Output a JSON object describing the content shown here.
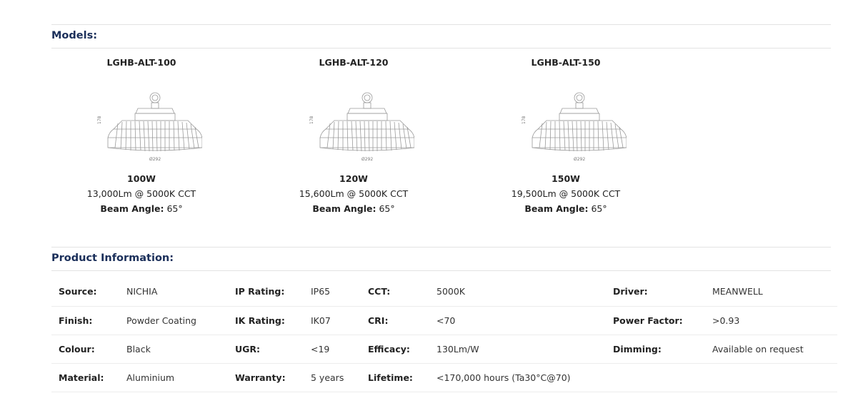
{
  "models_heading": "Models:",
  "product_info_heading": "Product Information:",
  "models": [
    {
      "name": "LGHB-ALT-100",
      "height_dim": "178",
      "width_dim": "Ø292",
      "wattage": "100W",
      "lumen": "13,000Lm @ 5000K CCT",
      "beam_label": "Beam Angle:",
      "beam_value": " 65°"
    },
    {
      "name": "LGHB-ALT-120",
      "height_dim": "178",
      "width_dim": "Ø292",
      "wattage": "120W",
      "lumen": "15,600Lm @ 5000K CCT",
      "beam_label": "Beam Angle:",
      "beam_value": " 65°"
    },
    {
      "name": "LGHB-ALT-150",
      "height_dim": "178",
      "width_dim": "Ø292",
      "wattage": "150W",
      "lumen": "19,500Lm @ 5000K CCT",
      "beam_label": "Beam Angle:",
      "beam_value": " 65°"
    }
  ],
  "info_rows": [
    [
      {
        "label": "Source:",
        "value": "NICHIA"
      },
      {
        "label": "IP Rating:",
        "value": "IP65"
      },
      {
        "label": "CCT:",
        "value": "5000K"
      },
      {
        "label": "Driver:",
        "value": "MEANWELL"
      }
    ],
    [
      {
        "label": "Finish:",
        "value": "Powder Coating"
      },
      {
        "label": "IK Rating:",
        "value": "IK07"
      },
      {
        "label": "CRI:",
        "value": "<70"
      },
      {
        "label": "Power Factor:",
        "value": ">0.93"
      }
    ],
    [
      {
        "label": "Colour:",
        "value": "Black"
      },
      {
        "label": "UGR:",
        "value": "<19"
      },
      {
        "label": "Efficacy:",
        "value": "130Lm/W"
      },
      {
        "label": "Dimming:",
        "value": "Available on request"
      }
    ],
    [
      {
        "label": "Material:",
        "value": "Aluminium"
      },
      {
        "label": "Warranty:",
        "value": "5 years"
      },
      {
        "label": "Lifetime:",
        "value": "<170,000 hours (Ta30°C@70)"
      },
      {
        "label": "",
        "value": ""
      }
    ]
  ]
}
